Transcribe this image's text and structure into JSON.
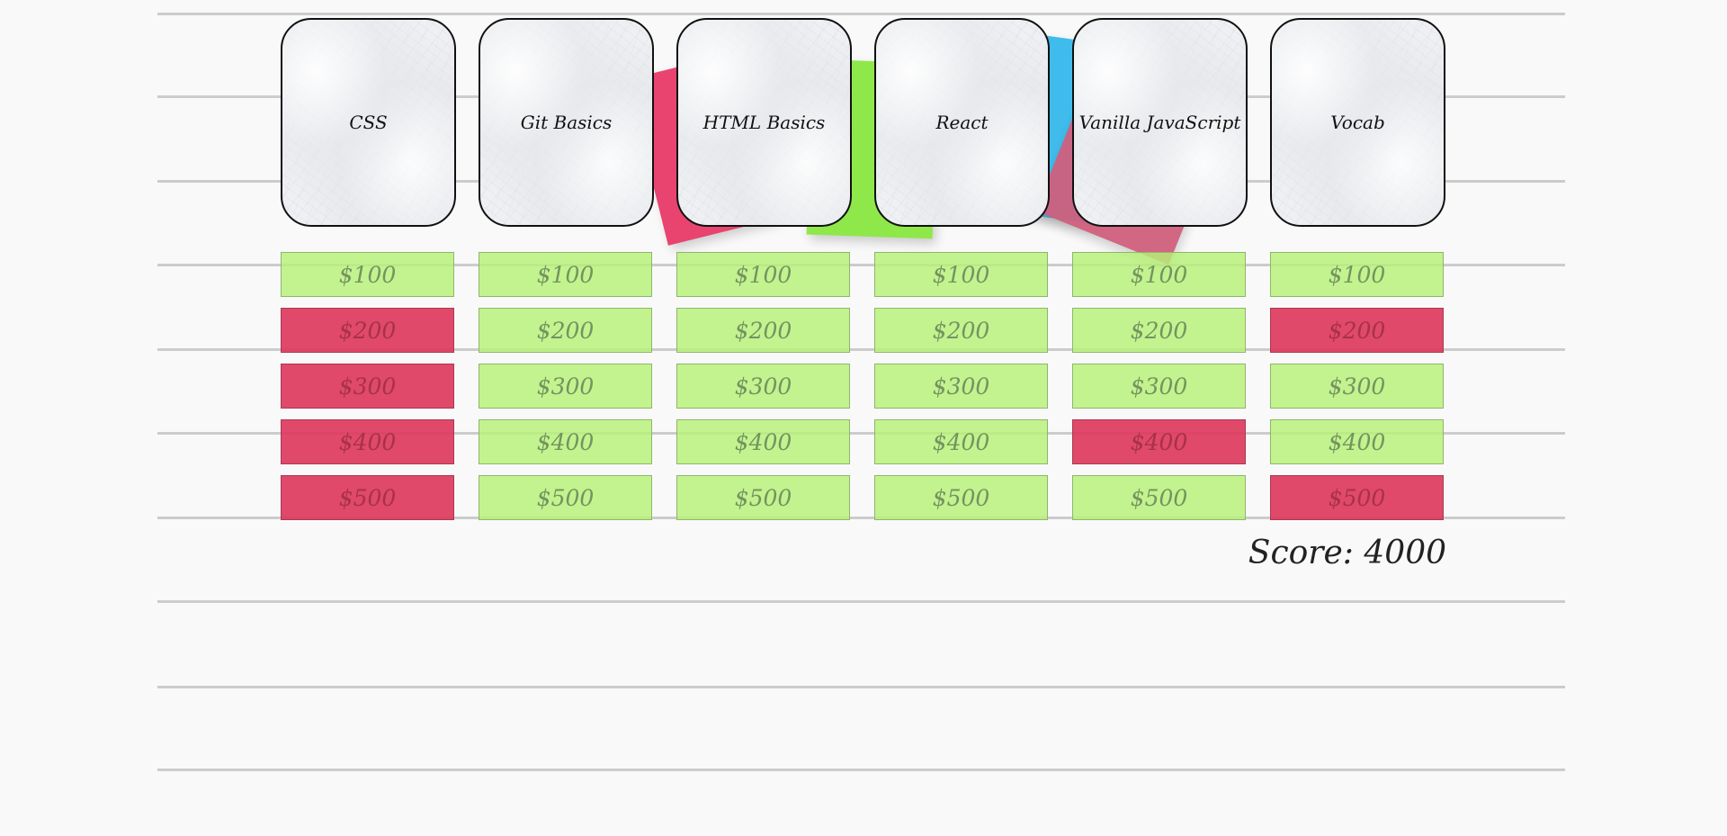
{
  "board": {
    "categories": [
      {
        "name": "CSS",
        "tiles": [
          {
            "label": "$100",
            "status": "open"
          },
          {
            "label": "$200",
            "status": "answered"
          },
          {
            "label": "$300",
            "status": "answered"
          },
          {
            "label": "$400",
            "status": "answered"
          },
          {
            "label": "$500",
            "status": "answered"
          }
        ]
      },
      {
        "name": "Git Basics",
        "tiles": [
          {
            "label": "$100",
            "status": "open"
          },
          {
            "label": "$200",
            "status": "open"
          },
          {
            "label": "$300",
            "status": "open"
          },
          {
            "label": "$400",
            "status": "open"
          },
          {
            "label": "$500",
            "status": "open"
          }
        ]
      },
      {
        "name": "HTML Basics",
        "tiles": [
          {
            "label": "$100",
            "status": "open"
          },
          {
            "label": "$200",
            "status": "open"
          },
          {
            "label": "$300",
            "status": "open"
          },
          {
            "label": "$400",
            "status": "open"
          },
          {
            "label": "$500",
            "status": "open"
          }
        ]
      },
      {
        "name": "React",
        "tiles": [
          {
            "label": "$100",
            "status": "open"
          },
          {
            "label": "$200",
            "status": "open"
          },
          {
            "label": "$300",
            "status": "open"
          },
          {
            "label": "$400",
            "status": "open"
          },
          {
            "label": "$500",
            "status": "open"
          }
        ]
      },
      {
        "name": "Vanilla JavaScript",
        "tiles": [
          {
            "label": "$100",
            "status": "open"
          },
          {
            "label": "$200",
            "status": "open"
          },
          {
            "label": "$300",
            "status": "open"
          },
          {
            "label": "$400",
            "status": "answered"
          },
          {
            "label": "$500",
            "status": "open"
          }
        ]
      },
      {
        "name": "Vocab",
        "tiles": [
          {
            "label": "$100",
            "status": "open"
          },
          {
            "label": "$200",
            "status": "answered"
          },
          {
            "label": "$300",
            "status": "open"
          },
          {
            "label": "$400",
            "status": "open"
          },
          {
            "label": "$500",
            "status": "answered"
          }
        ]
      }
    ]
  },
  "score_text": "Score: 4000",
  "colors": {
    "open_tile": "#b7f276",
    "answered_tile": "#dd3a5c",
    "note_pink": "#e8446f",
    "note_green": "#8fe84a",
    "note_blue": "#3fbcec",
    "note_rose": "#d0607e",
    "rule_line": "#cccccc",
    "page_background": "#f9f9f9"
  }
}
